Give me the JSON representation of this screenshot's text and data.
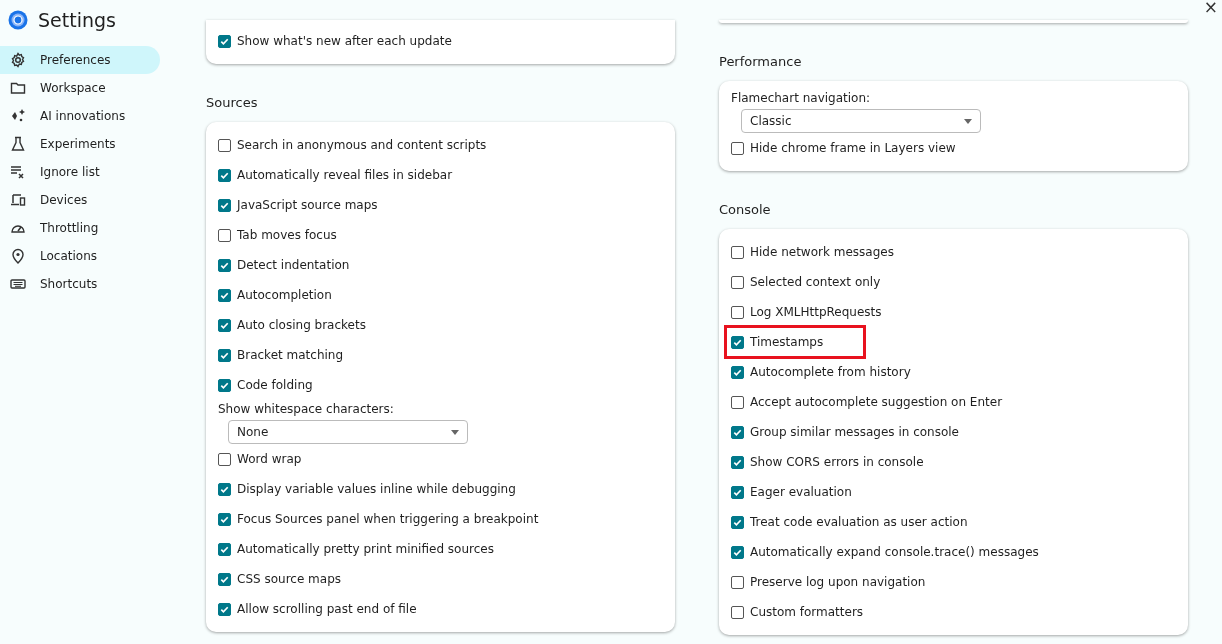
{
  "window": {
    "title": "Settings",
    "close": "×"
  },
  "sidebar": {
    "items": [
      {
        "label": "Preferences",
        "selected": true
      },
      {
        "label": "Workspace",
        "selected": false
      },
      {
        "label": "AI innovations",
        "selected": false
      },
      {
        "label": "Experiments",
        "selected": false
      },
      {
        "label": "Ignore list",
        "selected": false
      },
      {
        "label": "Devices",
        "selected": false
      },
      {
        "label": "Throttling",
        "selected": false
      },
      {
        "label": "Locations",
        "selected": false
      },
      {
        "label": "Shortcuts",
        "selected": false
      }
    ]
  },
  "columns": [
    {
      "sections": [
        {
          "items": [
            {
              "kind": "checkbox",
              "label": "Show what's new after each update",
              "checked": true
            }
          ]
        },
        {
          "title": "Sources",
          "items": [
            {
              "kind": "checkbox",
              "label": "Search in anonymous and content scripts",
              "checked": false
            },
            {
              "kind": "checkbox",
              "label": "Automatically reveal files in sidebar",
              "checked": true
            },
            {
              "kind": "checkbox",
              "label": "JavaScript source maps",
              "checked": true
            },
            {
              "kind": "checkbox",
              "label": "Tab moves focus",
              "checked": false
            },
            {
              "kind": "checkbox",
              "label": "Detect indentation",
              "checked": true
            },
            {
              "kind": "checkbox",
              "label": "Autocompletion",
              "checked": true
            },
            {
              "kind": "checkbox",
              "label": "Auto closing brackets",
              "checked": true
            },
            {
              "kind": "checkbox",
              "label": "Bracket matching",
              "checked": true
            },
            {
              "kind": "checkbox",
              "label": "Code folding",
              "checked": true
            },
            {
              "kind": "select",
              "label": "Show whitespace characters:",
              "value": "None"
            },
            {
              "kind": "checkbox",
              "label": "Word wrap",
              "checked": false
            },
            {
              "kind": "checkbox",
              "label": "Display variable values inline while debugging",
              "checked": true
            },
            {
              "kind": "checkbox",
              "label": "Focus Sources panel when triggering a breakpoint",
              "checked": true
            },
            {
              "kind": "checkbox",
              "label": "Automatically pretty print minified sources",
              "checked": true
            },
            {
              "kind": "checkbox",
              "label": "CSS source maps",
              "checked": true
            },
            {
              "kind": "checkbox",
              "label": "Allow scrolling past end of file",
              "checked": true
            }
          ]
        }
      ]
    },
    {
      "sections": [
        {
          "kind": "edge"
        },
        {
          "title": "Performance",
          "items": [
            {
              "kind": "select",
              "label": "Flamechart navigation:",
              "value": "Classic"
            },
            {
              "kind": "checkbox",
              "label": "Hide chrome frame in Layers view",
              "checked": false
            }
          ]
        },
        {
          "title": "Console",
          "items": [
            {
              "kind": "checkbox",
              "label": "Hide network messages",
              "checked": false
            },
            {
              "kind": "checkbox",
              "label": "Selected context only",
              "checked": false
            },
            {
              "kind": "checkbox",
              "label": "Log XMLHttpRequests",
              "checked": false
            },
            {
              "kind": "checkbox",
              "label": "Timestamps",
              "checked": true,
              "highlighted": true
            },
            {
              "kind": "checkbox",
              "label": "Autocomplete from history",
              "checked": true
            },
            {
              "kind": "checkbox",
              "label": "Accept autocomplete suggestion on Enter",
              "checked": false
            },
            {
              "kind": "checkbox",
              "label": "Group similar messages in console",
              "checked": true
            },
            {
              "kind": "checkbox",
              "label": "Show CORS errors in console",
              "checked": true
            },
            {
              "kind": "checkbox",
              "label": "Eager evaluation",
              "checked": true
            },
            {
              "kind": "checkbox",
              "label": "Treat code evaluation as user action",
              "checked": true
            },
            {
              "kind": "checkbox",
              "label": "Automatically expand console.trace() messages",
              "checked": true
            },
            {
              "kind": "checkbox",
              "label": "Preserve log upon navigation",
              "checked": false
            },
            {
              "kind": "checkbox",
              "label": "Custom formatters",
              "checked": false
            }
          ]
        }
      ]
    }
  ]
}
